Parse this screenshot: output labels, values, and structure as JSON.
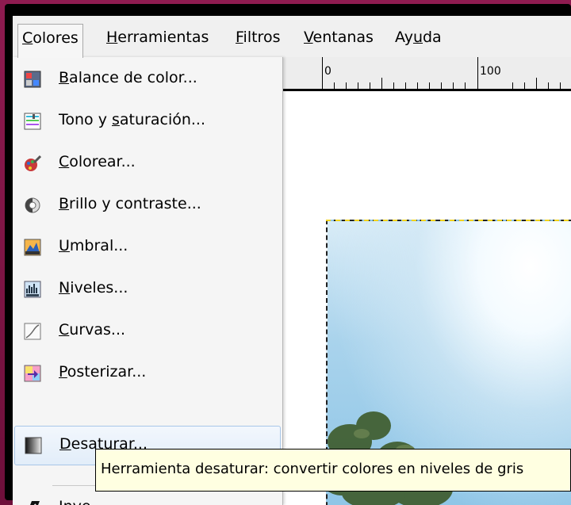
{
  "menubar": {
    "items": [
      {
        "pre": "",
        "ul": "C",
        "post": "olores"
      },
      {
        "pre": "",
        "ul": "H",
        "post": "erramientas"
      },
      {
        "pre": "",
        "ul": "F",
        "post": "iltros"
      },
      {
        "pre": "",
        "ul": "V",
        "post": "entanas"
      },
      {
        "pre": "Ay",
        "ul": "u",
        "post": "da"
      }
    ]
  },
  "ruler": {
    "labels": [
      "0",
      "100"
    ]
  },
  "menu": {
    "items": [
      {
        "icon": "color-balance-icon",
        "pre": "",
        "ul": "B",
        "post": "alance de color..."
      },
      {
        "icon": "hue-saturation-icon",
        "pre": "Tono y ",
        "ul": "s",
        "post": "aturación..."
      },
      {
        "icon": "colorize-icon",
        "pre": "",
        "ul": "C",
        "post": "olorear..."
      },
      {
        "icon": "brightness-contrast-icon",
        "pre": "",
        "ul": "B",
        "post": "rillo y contraste..."
      },
      {
        "icon": "threshold-icon",
        "pre": "",
        "ul": "U",
        "post": "mbral..."
      },
      {
        "icon": "levels-icon",
        "pre": "",
        "ul": "N",
        "post": "iveles..."
      },
      {
        "icon": "curves-icon",
        "pre": "",
        "ul": "C",
        "post": "urvas..."
      },
      {
        "icon": "posterize-icon",
        "pre": "",
        "ul": "P",
        "post": "osterizar..."
      },
      {
        "icon": "desaturate-icon",
        "pre": "",
        "ul": "D",
        "post": "esaturar..."
      },
      {
        "icon": "invert-icon",
        "pre": "",
        "ul": "I",
        "post": "nve"
      }
    ],
    "highlighted_index": 8
  },
  "tooltip": {
    "text": "Herramienta desaturar: convertir colores en niveles de gris"
  },
  "colors": {
    "frame": "#7a1442",
    "highlight_border": "#a8c6e8",
    "tooltip_bg": "#ffffe1"
  }
}
